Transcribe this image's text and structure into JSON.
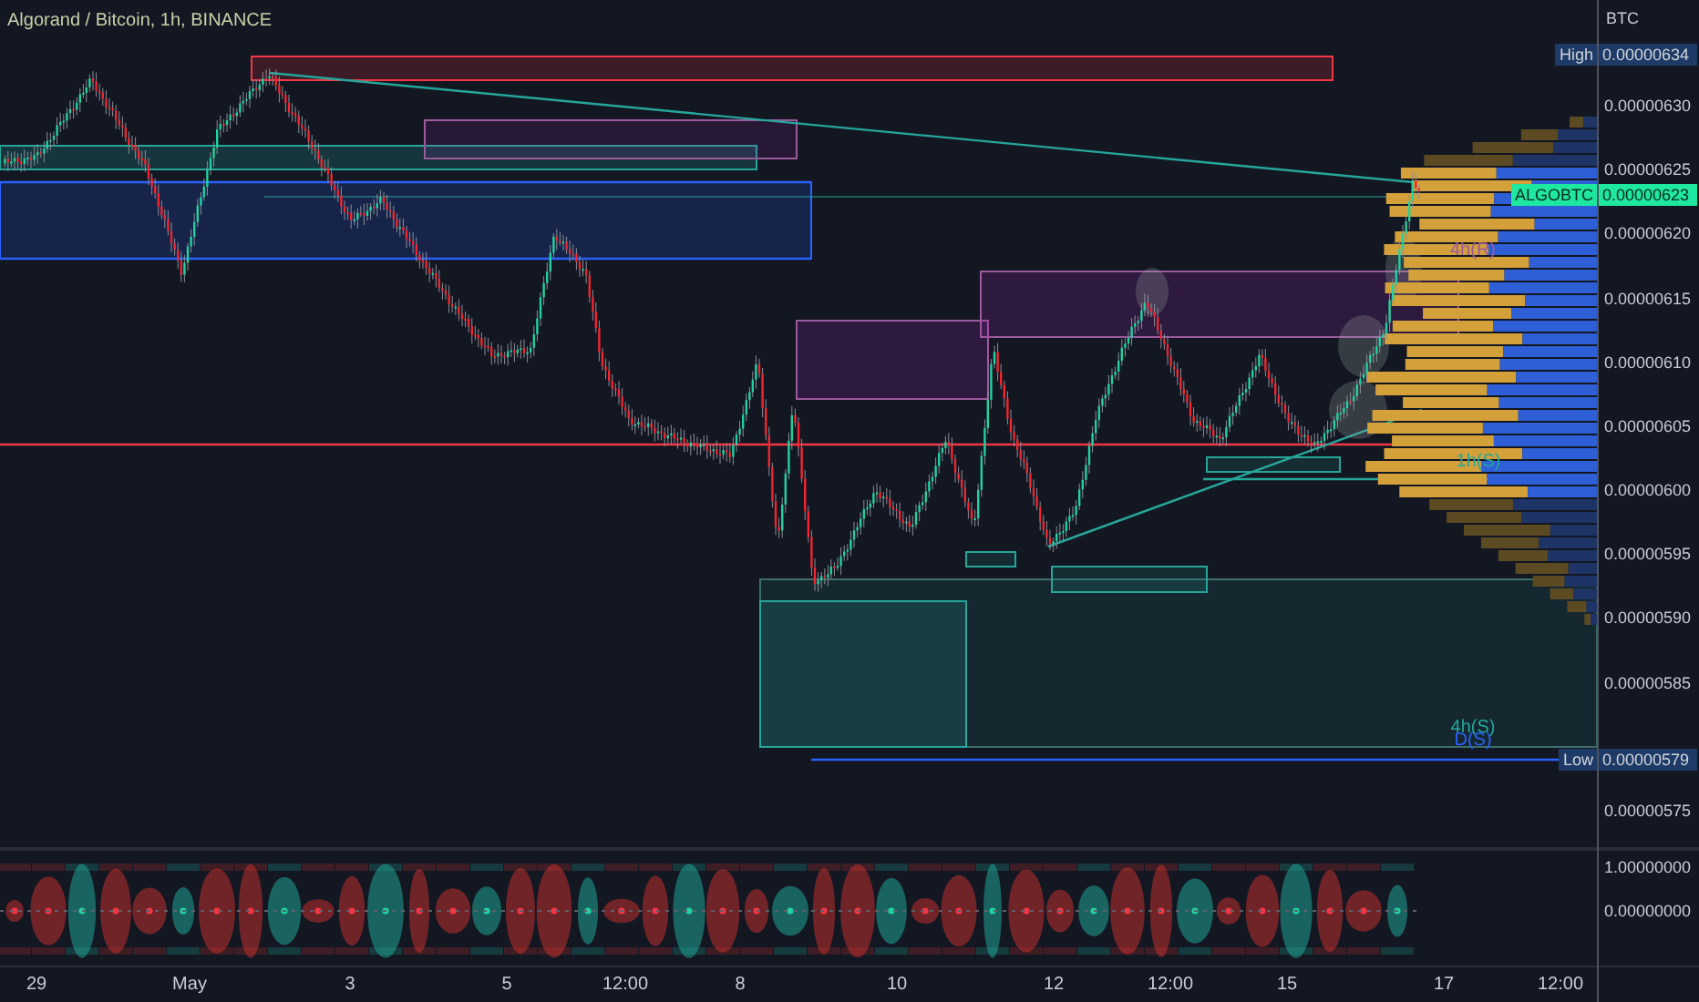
{
  "chart": {
    "title": "Algorand / Bitcoin, 1h, BINANCE",
    "level_labels": [
      {
        "text": "4h(R)",
        "color": "#9c5a9c"
      },
      {
        "text": "1h(S)",
        "color": "#26a69a"
      },
      {
        "text": "4h(S)",
        "color": "#26a69a"
      },
      {
        "text": "D(S)",
        "color": "#2962ff"
      }
    ]
  },
  "price_axis": {
    "unit": "BTC",
    "ticks": [
      "0.00000630",
      "0.00000625",
      "0.00000620",
      "0.00000615",
      "0.00000610",
      "0.00000605",
      "0.00000600",
      "0.00000595",
      "0.00000590",
      "0.00000585",
      "0.00000575"
    ],
    "markers": [
      {
        "kind": "high",
        "label": "High",
        "value": "0.00000634"
      },
      {
        "kind": "last",
        "label": "ALGOBTC",
        "value": "0.00000623"
      },
      {
        "kind": "low",
        "label": "Low",
        "value": "0.00000579"
      }
    ]
  },
  "time_axis": {
    "labels": [
      "29",
      "May",
      "3",
      "5",
      "12:00",
      "8",
      "10",
      "12",
      "12:00",
      "15",
      "17",
      "12:00"
    ]
  },
  "oscillator": {
    "ticks": [
      "1.00000000",
      "0.00000000"
    ]
  }
}
